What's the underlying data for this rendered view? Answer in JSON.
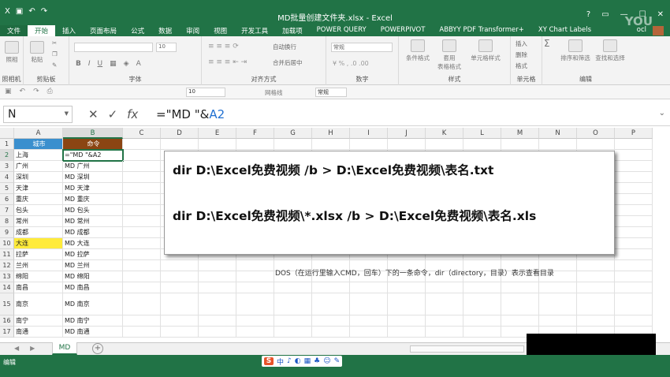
{
  "window": {
    "title": "MD批量创建文件夹.xlsx - Excel",
    "watermark": "YOU",
    "user_initial": "ocl"
  },
  "tabs": [
    {
      "label": "文件"
    },
    {
      "label": "开始",
      "active": true
    },
    {
      "label": "插入"
    },
    {
      "label": "页面布局"
    },
    {
      "label": "公式"
    },
    {
      "label": "数据"
    },
    {
      "label": "审阅"
    },
    {
      "label": "视图"
    },
    {
      "label": "开发工具"
    },
    {
      "label": "加载项"
    },
    {
      "label": "POWER QUERY"
    },
    {
      "label": "POWERPIVOT"
    },
    {
      "label": "ABBYY PDF Transformer+"
    },
    {
      "label": "XY Chart Labels"
    }
  ],
  "ribbon": {
    "groups": {
      "camera": "照相机",
      "clipboard": "剪贴板",
      "font": "字体",
      "alignment": "对齐方式",
      "number": "数字",
      "styles": "样式",
      "cells": "单元格",
      "editing": "编辑"
    },
    "buttons": {
      "camera": "照相",
      "paste": "粘贴",
      "wrap_text": "自动换行",
      "merge_center": "合并后居中",
      "number_format": "常规",
      "conditional_format": "条件格式",
      "format_as_table": "套用\n表格格式",
      "cell_styles": "单元格样式",
      "insert": "插入",
      "delete": "删除",
      "format": "格式",
      "sort_filter": "排序和筛选",
      "find_select": "查找和选择",
      "font_size": "10"
    },
    "toolbar2": {
      "font_size": "10",
      "grid": "网格线",
      "number_format": "常规"
    }
  },
  "formula_bar": {
    "name_box": "N",
    "fx_label": "fx",
    "formula_prefix": "=\"MD \"&",
    "formula_ref": "A2"
  },
  "columns": [
    "A",
    "B",
    "C",
    "D",
    "E",
    "F",
    "G",
    "H",
    "I",
    "J",
    "K",
    "L",
    "M",
    "N",
    "O",
    "P"
  ],
  "rows": [
    {
      "n": "1",
      "a": "城市",
      "b": "命令"
    },
    {
      "n": "2",
      "a": "上海",
      "b": "=\"MD \"&A2"
    },
    {
      "n": "3",
      "a": "广州",
      "b": "MD 广州"
    },
    {
      "n": "4",
      "a": "深圳",
      "b": "MD 深圳"
    },
    {
      "n": "5",
      "a": "天津",
      "b": "MD 天津"
    },
    {
      "n": "6",
      "a": "重庆",
      "b": "MD 重庆"
    },
    {
      "n": "7",
      "a": "包头",
      "b": "MD 包头"
    },
    {
      "n": "8",
      "a": "常州",
      "b": "MD 常州"
    },
    {
      "n": "9",
      "a": "成都",
      "b": "MD 成都"
    },
    {
      "n": "10",
      "a": "大连",
      "b": "MD 大连"
    },
    {
      "n": "11",
      "a": "拉萨",
      "b": "MD 拉萨"
    },
    {
      "n": "12",
      "a": "兰州",
      "b": "MD 兰州"
    },
    {
      "n": "13",
      "a": "绵阳",
      "b": "MD 绵阳"
    },
    {
      "n": "14",
      "a": "南昌",
      "b": "MD 南昌"
    },
    {
      "n": "15",
      "a": "南京",
      "b": "MD 南京"
    },
    {
      "n": "16",
      "a": "南宁",
      "b": "MD 南宁"
    },
    {
      "n": "17",
      "a": "南通",
      "b": "MD 南通"
    }
  ],
  "callout": {
    "line1": "dir D:\\Excel免费视频 /b > D:\\Excel免费视频\\表名.txt",
    "line2": "dir D:\\Excel免费视频\\*.xlsx /b > D:\\Excel免费视频\\表名.xls"
  },
  "note": "DOS（在运行里输入CMD，回车）下的一条命令，dir（directory，目录）表示查看目录",
  "sheet_tab": "MD",
  "status": {
    "mode": "编辑",
    "ime": [
      "S",
      "中",
      "♪",
      "◐",
      "▦",
      "♣",
      "☺",
      "✎"
    ]
  }
}
